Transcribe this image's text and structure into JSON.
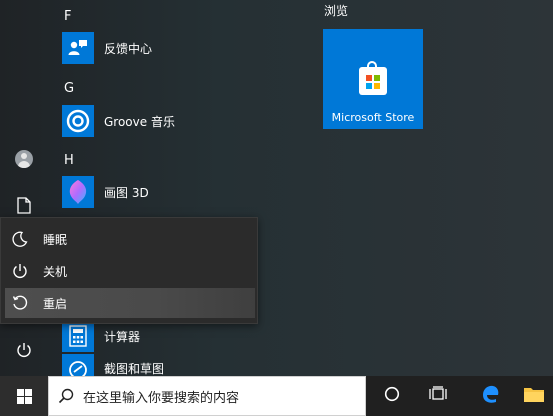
{
  "colors": {
    "accent": "#0078d7",
    "menu_bg": "#2b2b2b",
    "taskbar_bg": "#202020"
  },
  "rail": {
    "icons": [
      "avatar",
      "document-icon",
      "power-icon"
    ]
  },
  "app_list": {
    "groups": [
      {
        "letter": "F",
        "apps": [
          {
            "label": "反馈中心",
            "icon": "feedback-hub-icon"
          }
        ]
      },
      {
        "letter": "G",
        "apps": [
          {
            "label": "Groove 音乐",
            "icon": "groove-music-icon"
          }
        ]
      },
      {
        "letter": "H",
        "apps": [
          {
            "label": "画图 3D",
            "icon": "paint-3d-icon"
          }
        ]
      }
    ],
    "more_apps": [
      {
        "label": "计算器",
        "icon": "calculator-icon"
      },
      {
        "label": "截图和草图",
        "icon": "snip-sketch-icon"
      }
    ]
  },
  "tiles": {
    "section_title": "浏览",
    "store": {
      "label": "Microsoft Store",
      "icon": "store-bag-icon"
    }
  },
  "power_menu": {
    "items": [
      {
        "label": "睡眠",
        "icon": "moon-icon",
        "selected": false
      },
      {
        "label": "关机",
        "icon": "power-icon",
        "selected": false
      },
      {
        "label": "重启",
        "icon": "restart-icon",
        "selected": true
      }
    ]
  },
  "taskbar": {
    "search_placeholder": "在这里输入你要搜索的内容",
    "icons": [
      "windows-logo-icon",
      "search-icon",
      "cortana-icon",
      "task-view-icon",
      "edge-icon",
      "file-explorer-icon"
    ]
  }
}
